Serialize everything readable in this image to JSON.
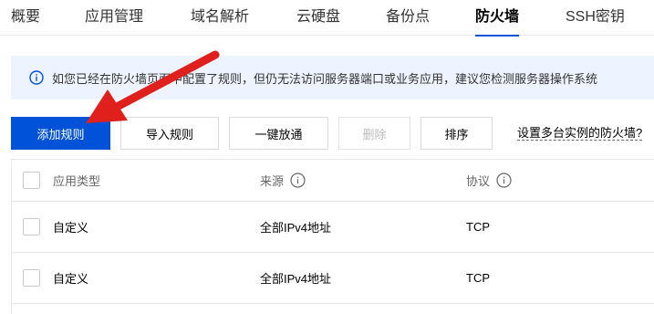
{
  "tabs": [
    {
      "label": "概要"
    },
    {
      "label": "应用管理"
    },
    {
      "label": "域名解析"
    },
    {
      "label": "云硬盘"
    },
    {
      "label": "备份点"
    },
    {
      "label": "防火墙",
      "active": true
    },
    {
      "label": "SSH密钥"
    }
  ],
  "notice": {
    "icon": "info-icon",
    "text": "如您已经在防火墙页面中配置了规则，但仍无法访问服务器端口或业务应用，建议您检测服务器操作系统"
  },
  "toolbar": {
    "add_rule": "添加规则",
    "import_rules": "导入规则",
    "one_click_allow": "一键放通",
    "delete": "删除",
    "sort": "排序",
    "multi_instance_link": "设置多台实例的防火墙?"
  },
  "table": {
    "columns": [
      {
        "label": "应用类型",
        "has_info": false
      },
      {
        "label": "来源",
        "has_info": true
      },
      {
        "label": "协议",
        "has_info": true
      }
    ],
    "rows": [
      {
        "app_type": "自定义",
        "source": "全部IPv4地址",
        "protocol": "TCP"
      },
      {
        "app_type": "自定义",
        "source": "全部IPv4地址",
        "protocol": "TCP"
      }
    ]
  },
  "colors": {
    "primary": "#0052d9",
    "notice_bg": "#eef4ff",
    "annotation_arrow": "#e0201c"
  }
}
